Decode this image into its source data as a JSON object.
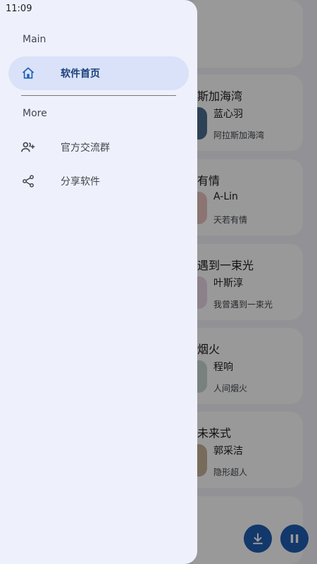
{
  "status_bar": {
    "time": "11:09"
  },
  "drawer": {
    "sections": [
      {
        "title": "Main",
        "items": [
          {
            "label": "软件首页",
            "icon": "home-icon",
            "active": true
          }
        ]
      },
      {
        "title": "More",
        "items": [
          {
            "label": "官方交流群",
            "icon": "group-add-icon",
            "active": false
          },
          {
            "label": "分享软件",
            "icon": "share-icon",
            "active": false
          }
        ]
      }
    ]
  },
  "toolbar": {
    "icons": [
      "search-icon",
      "playlist-icon",
      "download-icon"
    ]
  },
  "songs": [
    {
      "title": "斯加海湾",
      "artist": "蓝心羽",
      "album": "阿拉斯加海湾"
    },
    {
      "title": "有情",
      "artist": "A-Lin",
      "album": "天若有情"
    },
    {
      "title": "遇到一束光",
      "artist": "叶斯淳",
      "album": "我曾遇到一束光"
    },
    {
      "title": "烟火",
      "artist": "程响",
      "album": "人间烟火"
    },
    {
      "title": "未来式",
      "artist": "郭采洁",
      "album": "隐形超人"
    }
  ],
  "fabs": [
    "download-icon",
    "pause-icon"
  ],
  "colors": {
    "accent": "#1e5eb4",
    "drawer_bg": "#eef1fb",
    "active_item_bg": "#d9e2f8"
  }
}
